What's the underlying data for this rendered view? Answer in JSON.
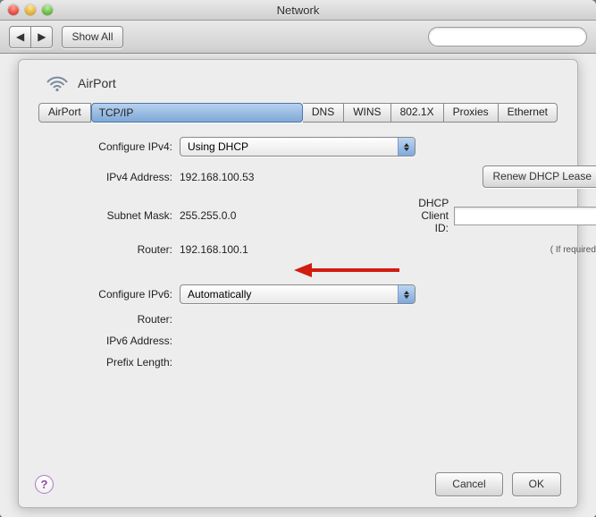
{
  "window": {
    "title": "Network"
  },
  "toolbar": {
    "back_glyph": "◀",
    "fwd_glyph": "▶",
    "show_all": "Show All",
    "search_placeholder": ""
  },
  "service": {
    "name": "AirPort"
  },
  "tabs": [
    {
      "label": "AirPort"
    },
    {
      "label": "TCP/IP"
    },
    {
      "label": "DNS"
    },
    {
      "label": "WINS"
    },
    {
      "label": "802.1X"
    },
    {
      "label": "Proxies"
    },
    {
      "label": "Ethernet"
    }
  ],
  "selected_tab": 1,
  "ipv4": {
    "configure_label": "Configure IPv4:",
    "configure_value": "Using DHCP",
    "address_label": "IPv4 Address:",
    "address_value": "192.168.100.53",
    "subnet_label": "Subnet Mask:",
    "subnet_value": "255.255.0.0",
    "router_label": "Router:",
    "router_value": "192.168.100.1",
    "renew_label": "Renew DHCP Lease",
    "client_id_label": "DHCP Client ID:",
    "client_id_value": "",
    "client_id_hint": "( If required )"
  },
  "ipv6": {
    "configure_label": "Configure IPv6:",
    "configure_value": "Automatically",
    "router_label": "Router:",
    "router_value": "",
    "address_label": "IPv6 Address:",
    "address_value": "",
    "prefix_label": "Prefix Length:",
    "prefix_value": ""
  },
  "footer": {
    "help_glyph": "?",
    "cancel": "Cancel",
    "ok": "OK"
  },
  "arrow": {
    "color": "#d11c0f"
  }
}
